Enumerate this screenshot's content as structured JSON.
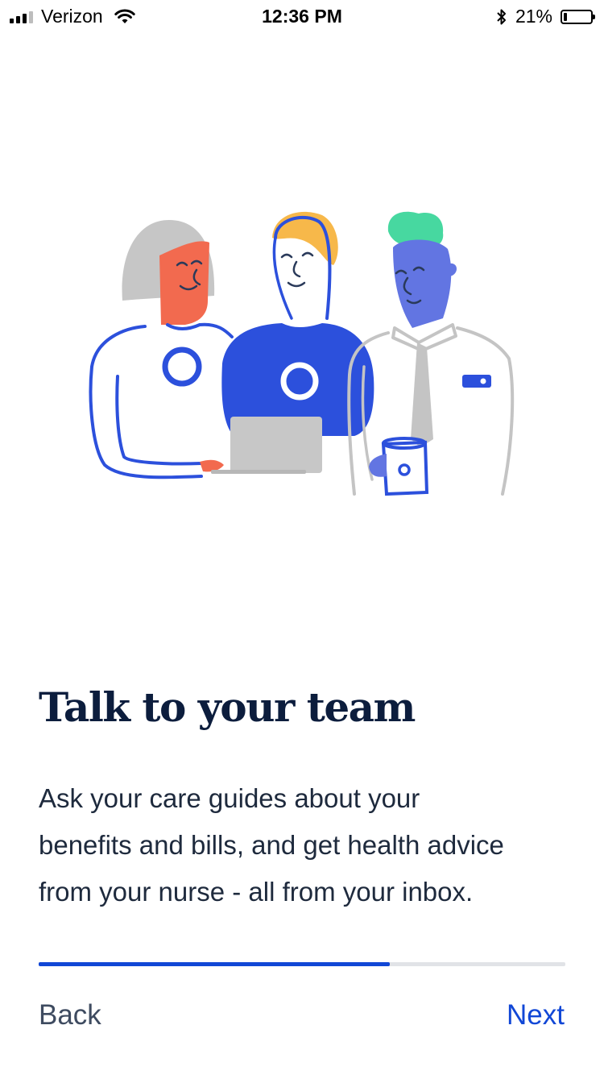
{
  "status_bar": {
    "carrier": "Verizon",
    "time": "12:36 PM",
    "battery_text": "21%",
    "battery_level": 0.21,
    "signal_bars": 3,
    "icons": [
      "signal-bars-icon",
      "wifi-icon",
      "bluetooth-icon",
      "battery-icon"
    ]
  },
  "illustration": {
    "icon": "care-team-illustration",
    "colors": {
      "blue": "#2c50dc",
      "coral": "#f26a4f",
      "gray": "#c4c4c4",
      "yellow": "#f7b84a",
      "mint": "#47d8a0",
      "periwinkle": "#6275e2"
    }
  },
  "onboarding": {
    "title": "Talk to your team",
    "description_lines": [
      "Ask your care guides about your",
      "benefits and bills, and get health advice",
      "from your nurse - all from your inbox."
    ],
    "progress": 0.667
  },
  "navigation": {
    "back_label": "Back",
    "next_label": "Next"
  },
  "colors": {
    "accent": "#1147d6",
    "title": "#0c1d3d",
    "track": "#e1e3e7"
  }
}
